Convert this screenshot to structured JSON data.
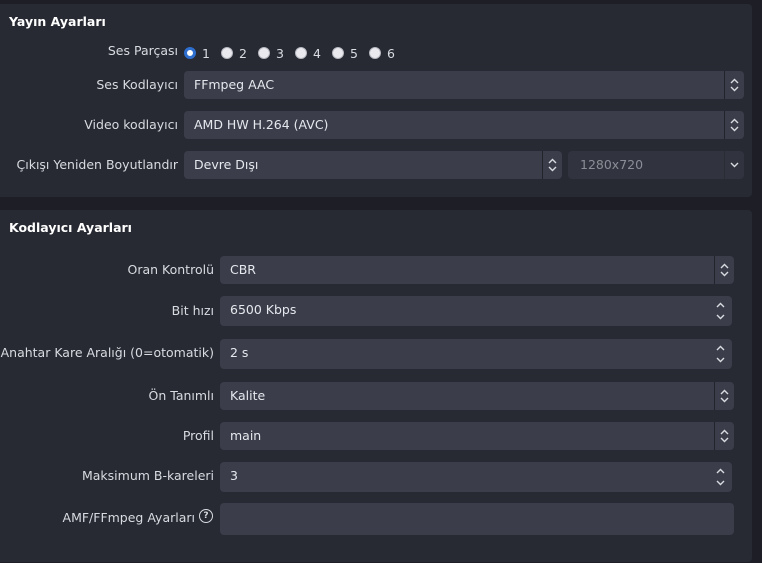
{
  "stream_settings": {
    "title": "Yayın Ayarları",
    "audio_track": {
      "label": "Ses Parçası",
      "options": [
        "1",
        "2",
        "3",
        "4",
        "5",
        "6"
      ],
      "selected": "1"
    },
    "audio_encoder": {
      "label": "Ses Kodlayıcı",
      "value": "FFmpeg AAC"
    },
    "video_encoder": {
      "label": "Video kodlayıcı",
      "value": "AMD HW H.264 (AVC)"
    },
    "rescale": {
      "label": "Çıkışı Yeniden Boyutlandır",
      "value": "Devre Dışı",
      "resolution": "1280x720"
    }
  },
  "encoder_settings": {
    "title": "Kodlayıcı Ayarları",
    "rate_control": {
      "label": "Oran Kontrolü",
      "value": "CBR"
    },
    "bitrate": {
      "label": "Bit hızı",
      "value": "6500 Kbps"
    },
    "keyframe_interval": {
      "label": "Anahtar Kare Aralığı (0=otomatik)",
      "value": "2 s"
    },
    "preset": {
      "label": "Ön Tanımlı",
      "value": "Kalite"
    },
    "profile": {
      "label": "Profil",
      "value": "main"
    },
    "max_bframes": {
      "label": "Maksimum B-kareleri",
      "value": "3"
    },
    "amf_options": {
      "label": "AMF/FFmpeg Ayarları",
      "value": ""
    }
  },
  "colors": {
    "panel": "#272a33",
    "field": "#3b3e4a",
    "accent": "#2d6ecf",
    "background": "#1e1f26"
  }
}
